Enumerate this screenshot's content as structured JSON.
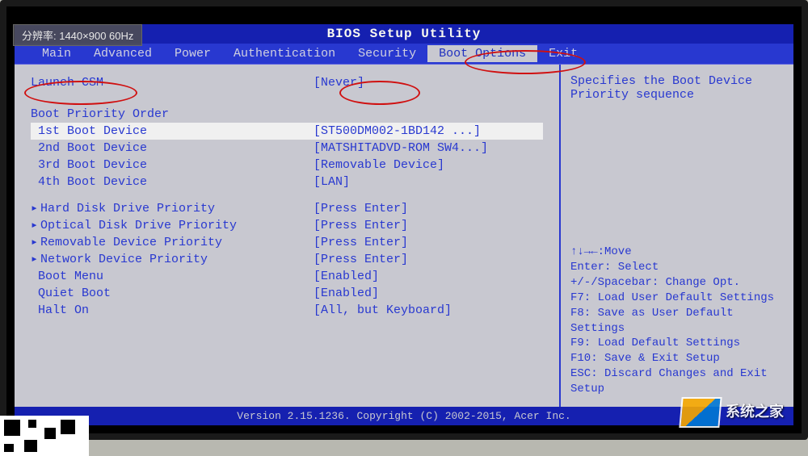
{
  "osd": {
    "text": "分辨率: 1440×900 60Hz"
  },
  "title": "BIOS Setup Utility",
  "menu": {
    "items": [
      {
        "label": "Main"
      },
      {
        "label": "Advanced"
      },
      {
        "label": "Power"
      },
      {
        "label": "Authentication"
      },
      {
        "label": "Security"
      },
      {
        "label": "Boot Options",
        "active": true
      },
      {
        "label": "Exit"
      }
    ]
  },
  "settings": {
    "launch_csm": {
      "label": "Launch CSM",
      "value": "[Never]"
    },
    "boot_priority_header": "Boot Priority Order",
    "boot_devices": [
      {
        "label": "1st Boot Device",
        "value": "[ST500DM002-1BD142  ...]",
        "highlighted": true
      },
      {
        "label": "2nd Boot Device",
        "value": "[MATSHITADVD-ROM SW4...]"
      },
      {
        "label": "3rd Boot Device",
        "value": "[Removable Device]"
      },
      {
        "label": "4th Boot Device",
        "value": "[LAN]"
      }
    ],
    "priorities": [
      {
        "label": "Hard Disk Drive Priority",
        "value": "[Press Enter]",
        "submenu": true
      },
      {
        "label": "Optical Disk Drive Priority",
        "value": "[Press Enter]",
        "submenu": true
      },
      {
        "label": "Removable Device Priority",
        "value": "[Press Enter]",
        "submenu": true
      },
      {
        "label": "Network Device Priority",
        "value": "[Press Enter]",
        "submenu": true
      }
    ],
    "options": [
      {
        "label": "Boot Menu",
        "value": "[Enabled]"
      },
      {
        "label": "Quiet Boot",
        "value": "[Enabled]"
      },
      {
        "label": "Halt On",
        "value": "[All, but Keyboard]"
      }
    ]
  },
  "help": {
    "description": "Specifies the Boot Device Priority sequence",
    "keys": [
      "↑↓→←:Move",
      "Enter: Select",
      "+/-/Spacebar: Change Opt.",
      "F7: Load User Default Settings",
      "F8: Save as User Default Settings",
      "F9: Load Default Settings",
      "F10: Save & Exit Setup",
      "ESC: Discard Changes and Exit Setup"
    ]
  },
  "footer": "Version 2.15.1236. Copyright (C) 2002-2015, Acer Inc.",
  "watermark": "系统之家"
}
